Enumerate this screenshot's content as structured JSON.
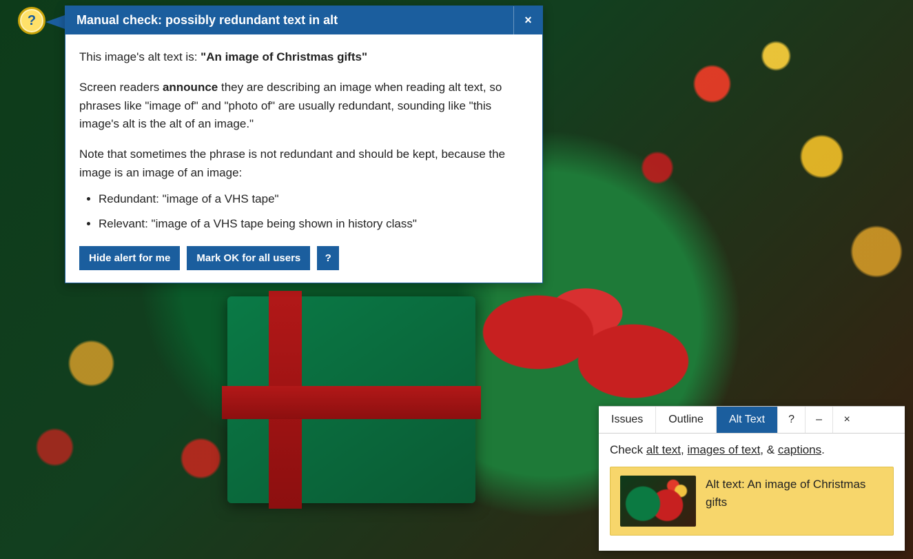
{
  "badge": {
    "glyph": "?"
  },
  "popup": {
    "title": "Manual check: possibly redundant text in alt",
    "close_glyph": "×",
    "intro_prefix": "This image's alt text is: ",
    "alt_quoted": "\"An image of Christmas gifts\"",
    "para1_pre": "Screen readers ",
    "para1_strong": "announce",
    "para1_post": " they are describing an image when reading alt text, so phrases like \"image of\" and \"photo of\" are usually redundant, sounding like \"this image's alt is the alt of an image.\"",
    "para2": "Note that sometimes the phrase is not redundant and should be kept, because the image is an image of an image:",
    "bullets": [
      "Redundant: \"image of a VHS tape\"",
      "Relevant: \"image of a VHS tape being shown in history class\""
    ],
    "actions": {
      "hide": "Hide alert for me",
      "mark_ok": "Mark OK for all users",
      "help": "?"
    }
  },
  "panel": {
    "tabs": {
      "issues": "Issues",
      "outline": "Outline",
      "alt_text": "Alt Text"
    },
    "util": {
      "help": "?",
      "min": "–",
      "close": "×"
    },
    "check_label": "Check ",
    "link_alt_text": "alt text",
    "sep1": ", ",
    "link_images_of_text": "images of text",
    "sep2": ", & ",
    "link_captions": "captions",
    "period": ".",
    "card_text": "Alt text: An image of Christmas gifts"
  }
}
